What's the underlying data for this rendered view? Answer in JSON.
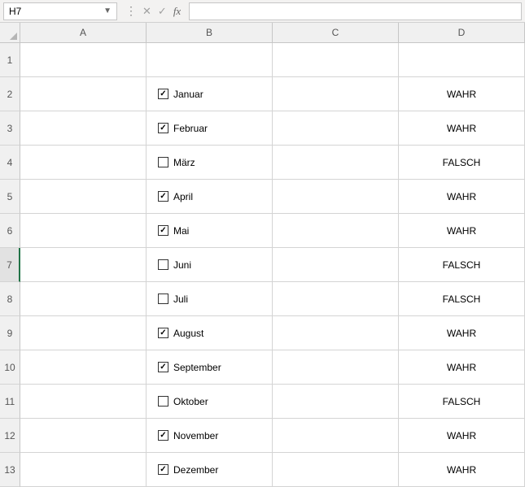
{
  "formula_bar": {
    "name_box_value": "H7",
    "formula_value": "",
    "cancel": "✕",
    "confirm": "✓"
  },
  "columns": [
    {
      "letter": "A",
      "width": 155
    },
    {
      "letter": "B",
      "width": 155
    },
    {
      "letter": "C",
      "width": 155
    },
    {
      "letter": "D",
      "width": 155
    }
  ],
  "rows": [
    {
      "num": "1",
      "height": 42,
      "checkbox": null,
      "checked": null,
      "d_value": ""
    },
    {
      "num": "2",
      "height": 42,
      "checkbox": "Januar",
      "checked": true,
      "d_value": "WAHR"
    },
    {
      "num": "3",
      "height": 42,
      "checkbox": "Februar",
      "checked": true,
      "d_value": "WAHR"
    },
    {
      "num": "4",
      "height": 42,
      "checkbox": "März",
      "checked": false,
      "d_value": "FALSCH"
    },
    {
      "num": "5",
      "height": 42,
      "checkbox": "April",
      "checked": true,
      "d_value": "WAHR"
    },
    {
      "num": "6",
      "height": 42,
      "checkbox": "Mai",
      "checked": true,
      "d_value": "WAHR"
    },
    {
      "num": "7",
      "height": 42,
      "checkbox": "Juni",
      "checked": false,
      "d_value": "FALSCH",
      "selected_row": true
    },
    {
      "num": "8",
      "height": 42,
      "checkbox": "Juli",
      "checked": false,
      "d_value": "FALSCH"
    },
    {
      "num": "9",
      "height": 42,
      "checkbox": "August",
      "checked": true,
      "d_value": "WAHR"
    },
    {
      "num": "10",
      "height": 42,
      "checkbox": "September",
      "checked": true,
      "d_value": "WAHR"
    },
    {
      "num": "11",
      "height": 42,
      "checkbox": "Oktober",
      "checked": false,
      "d_value": "FALSCH"
    },
    {
      "num": "12",
      "height": 42,
      "checkbox": "November",
      "checked": true,
      "d_value": "WAHR"
    },
    {
      "num": "13",
      "height": 42,
      "checkbox": "Dezember",
      "checked": true,
      "d_value": "WAHR"
    }
  ]
}
